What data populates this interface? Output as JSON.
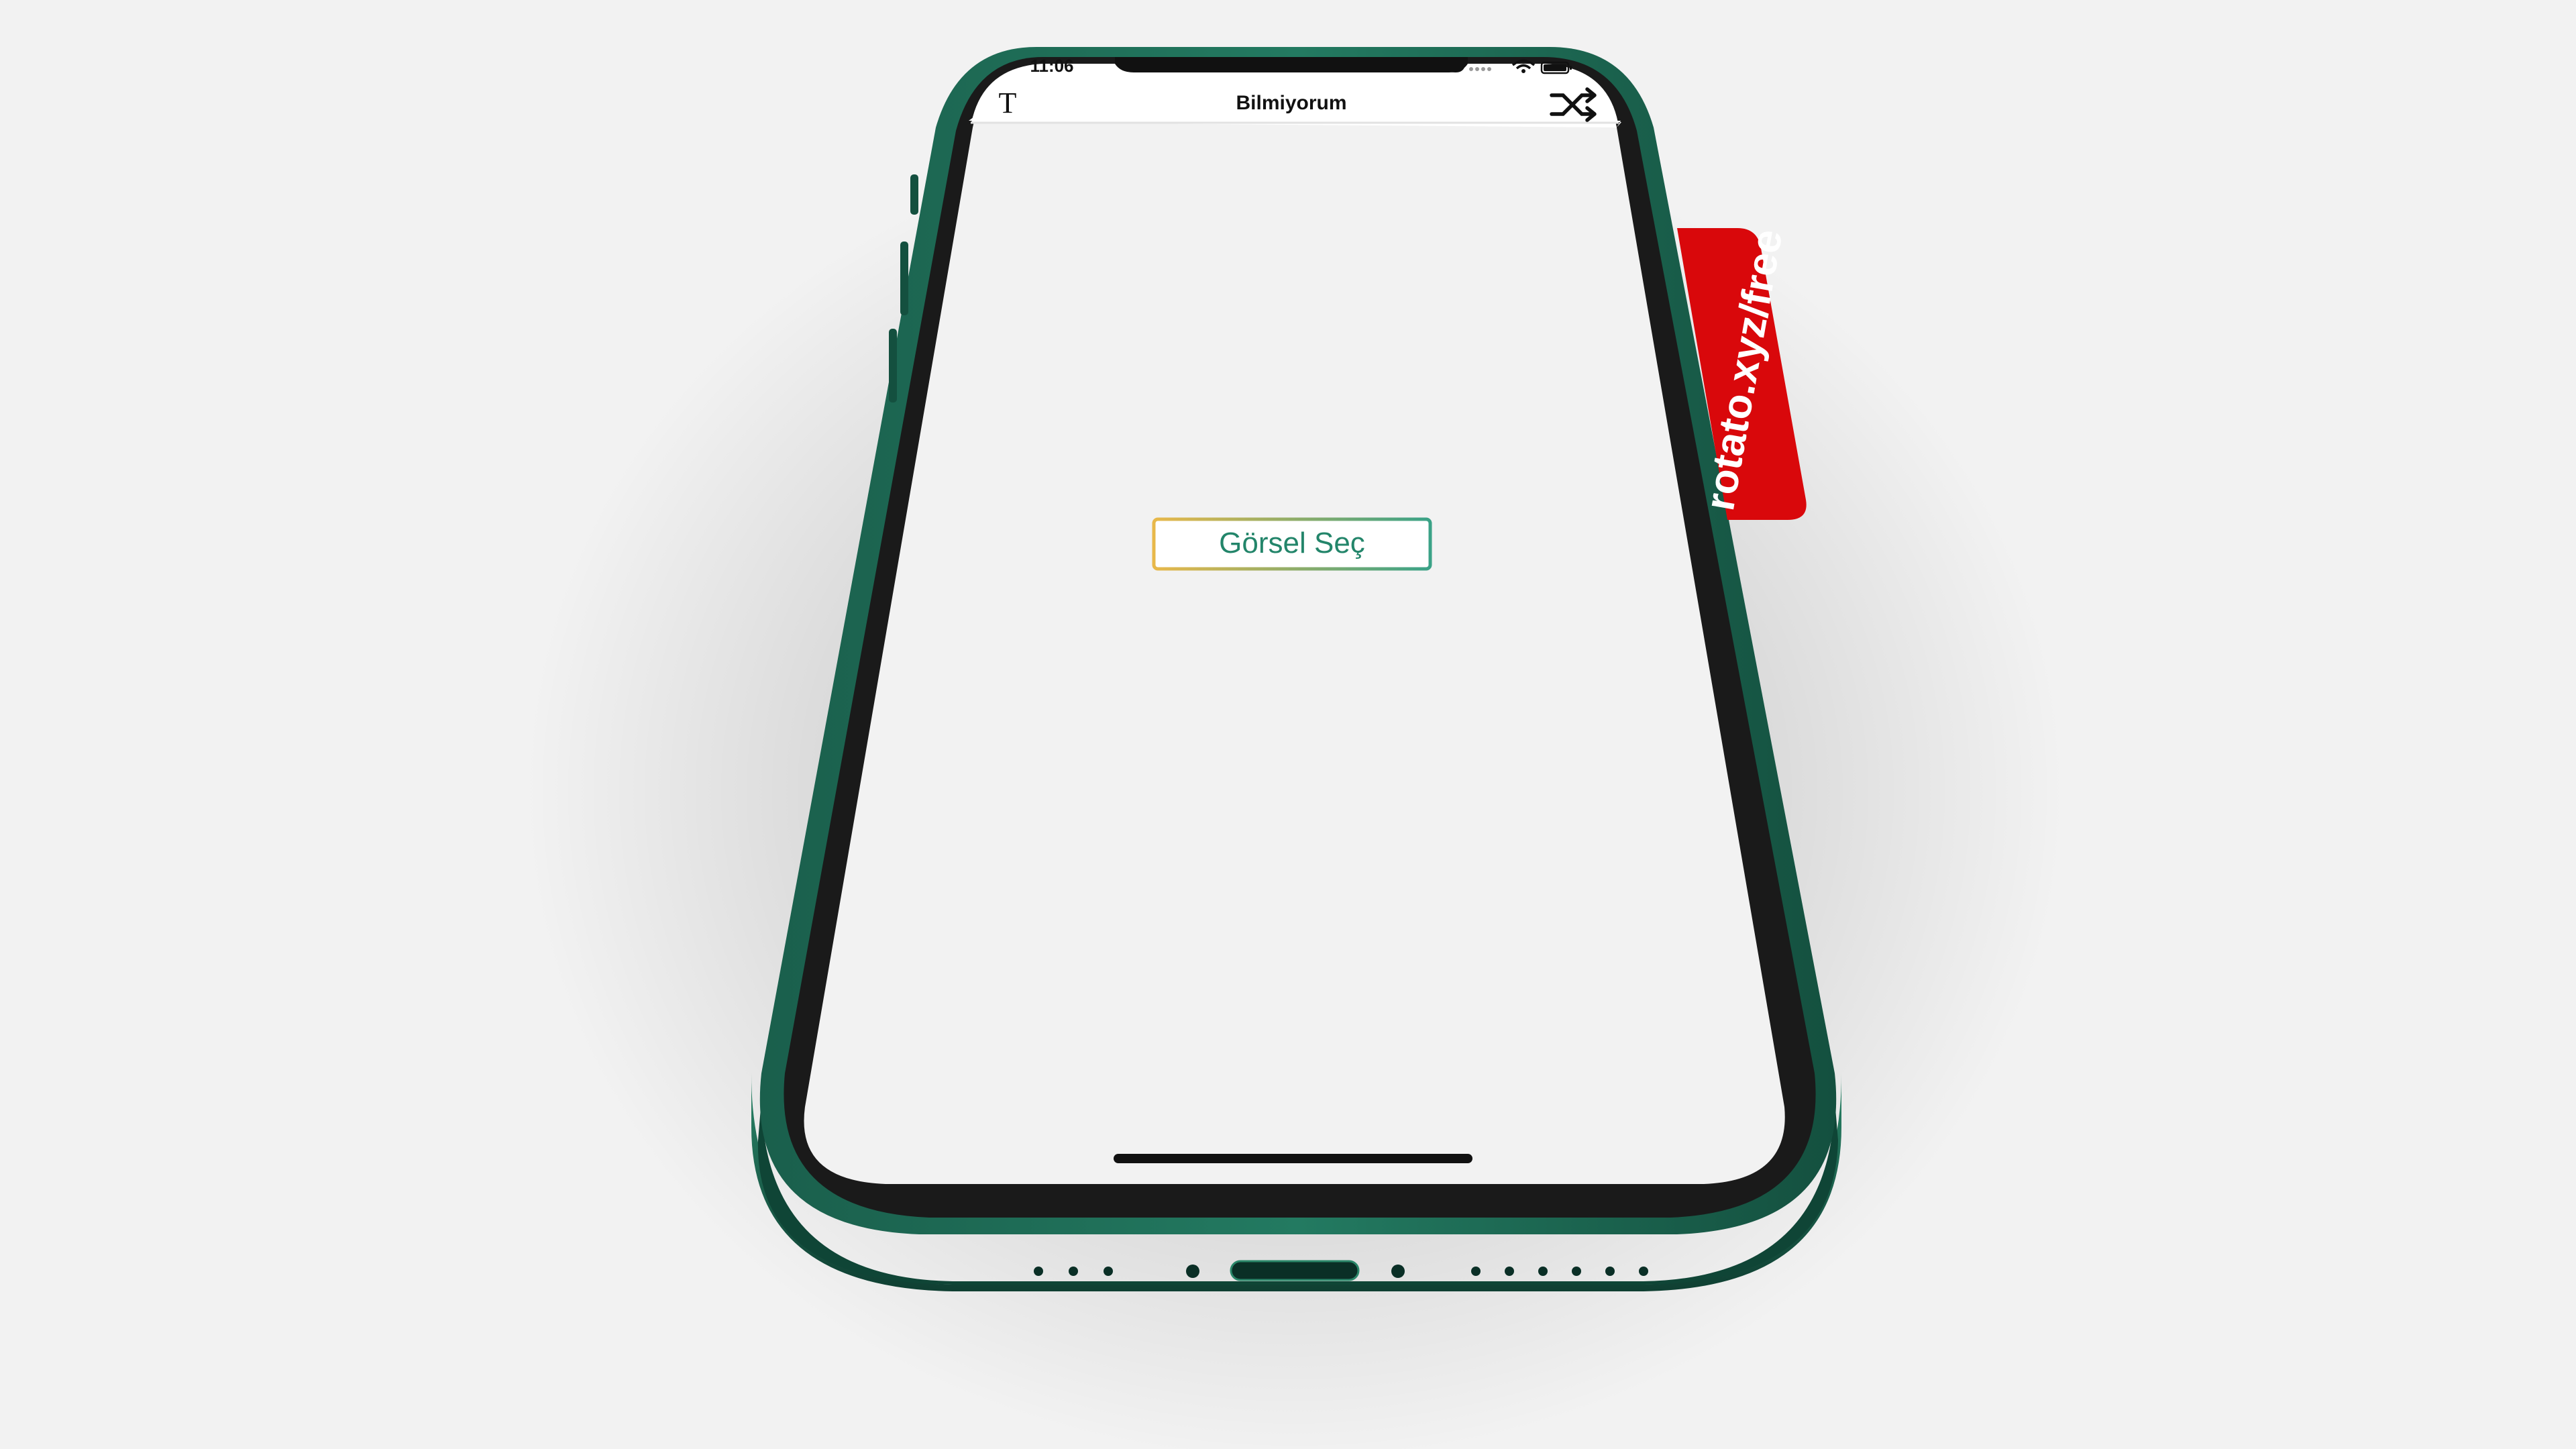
{
  "status_bar": {
    "time": "11:06",
    "signal_icon": "signal-dots-icon",
    "wifi_icon": "wifi-icon",
    "battery_icon": "battery-icon"
  },
  "nav_bar": {
    "title": "Bilmiyorum",
    "left_icon": "text-format-icon",
    "left_icon_glyph": "T",
    "right_icon": "shuffle-icon"
  },
  "main": {
    "select_image_button_label": "Görsel Seç"
  },
  "watermark": {
    "text": "rotato.xyz/free"
  },
  "colors": {
    "background": "#f2f2f2",
    "phone_frame": "#1d6b55",
    "phone_frame_dark": "#124a3b",
    "bezel": "#1a1a1a",
    "screen_background": "#f2f2f2",
    "nav_background": "#ffffff",
    "button_text": "#23856a",
    "button_border_gold": "#e8b84a",
    "button_border_green": "#3aa287",
    "watermark_red": "#d9080b",
    "home_indicator": "#111111"
  }
}
